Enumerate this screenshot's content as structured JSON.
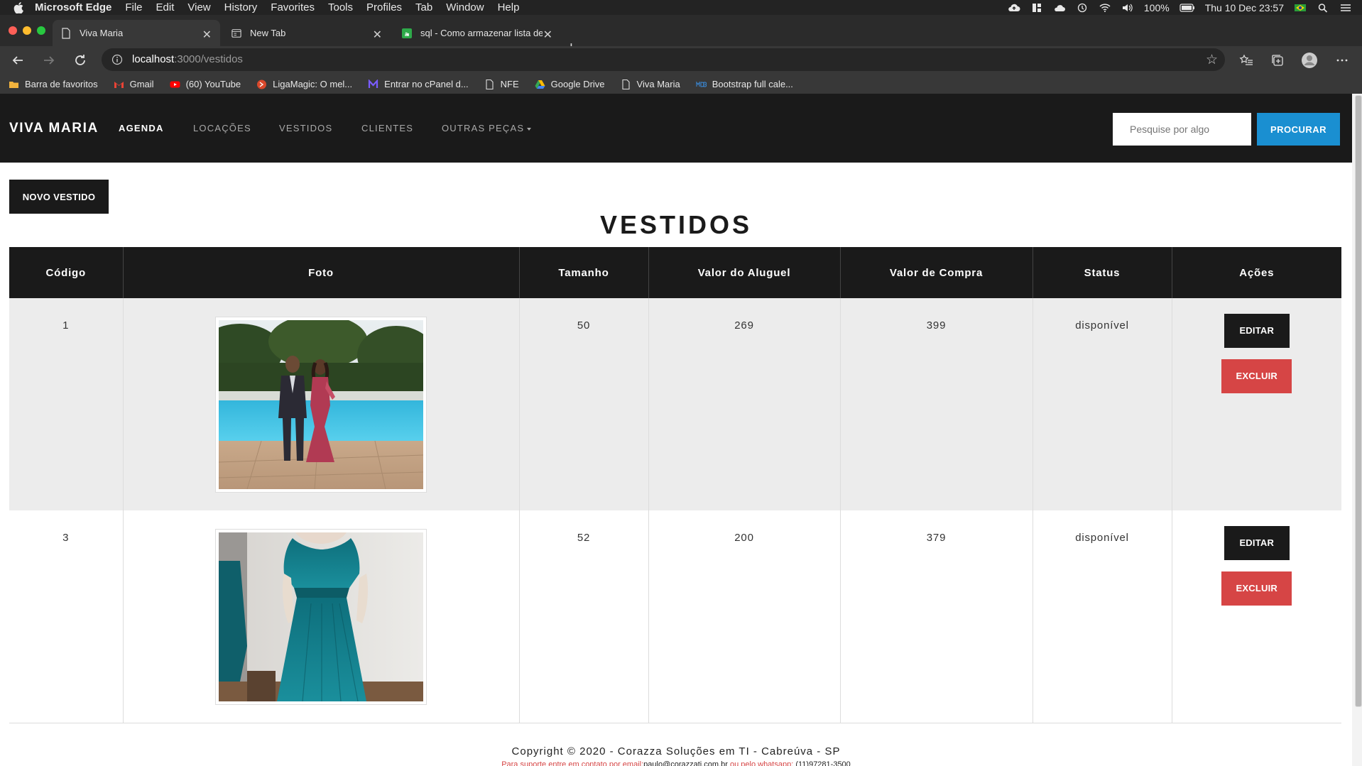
{
  "menubar": {
    "app": "Microsoft Edge",
    "items": [
      "File",
      "Edit",
      "View",
      "History",
      "Favorites",
      "Tools",
      "Profiles",
      "Tab",
      "Window",
      "Help"
    ],
    "battery": "100%",
    "datetime": "Thu 10 Dec  23:57"
  },
  "tabs": [
    {
      "label": "Viva Maria",
      "active": true
    },
    {
      "label": "New Tab",
      "active": false
    },
    {
      "label": "sql - Como armazenar lista de",
      "active": false
    }
  ],
  "address": {
    "host": "localhost",
    "path": ":3000/vestidos"
  },
  "bookmarks": [
    {
      "label": "Barra de favoritos",
      "icon": "folder-icon"
    },
    {
      "label": "Gmail",
      "icon": "gmail-icon"
    },
    {
      "label": "(60) YouTube",
      "icon": "youtube-icon"
    },
    {
      "label": "LigaMagic: O mel...",
      "icon": "ligamagic-icon"
    },
    {
      "label": "Entrar no cPanel d...",
      "icon": "cpanel-icon"
    },
    {
      "label": "NFE",
      "icon": "page-icon"
    },
    {
      "label": "Google Drive",
      "icon": "drive-icon"
    },
    {
      "label": "Viva Maria",
      "icon": "page-icon"
    },
    {
      "label": "Bootstrap full cale...",
      "icon": "mdb-icon"
    }
  ],
  "site": {
    "brand": "VIVA MARIA",
    "nav": {
      "agenda": "AGENDA",
      "locacoes": "LOCAÇÕES",
      "vestidos": "VESTIDOS",
      "clientes": "CLIENTES",
      "outras": "OUTRAS PEÇAS"
    },
    "search_placeholder": "Pesquise por algo",
    "search_button": "PROCURAR"
  },
  "main": {
    "new_button": "NOVO VESTIDO",
    "title": "VESTIDOS",
    "headers": {
      "codigo": "Código",
      "foto": "Foto",
      "tamanho": "Tamanho",
      "aluguel": "Valor do Aluguel",
      "compra": "Valor de Compra",
      "status": "Status",
      "acoes": "Ações"
    },
    "rows": [
      {
        "codigo": "1",
        "tamanho": "50",
        "aluguel": "269",
        "compra": "399",
        "status": "disponível",
        "edit": "EDITAR",
        "delete": "EXCLUIR"
      },
      {
        "codigo": "3",
        "tamanho": "52",
        "aluguel": "200",
        "compra": "379",
        "status": "disponível",
        "edit": "EDITAR",
        "delete": "EXCLUIR"
      }
    ]
  },
  "footer": {
    "copyright": "Copyright © 2020 - Corazza Soluções em TI - Cabreúva - SP",
    "support_prefix": "Para suporte entre em contato por email:",
    "email": "paulo@corazzati.com.br",
    "whatsapp_prefix": " ou pelo whatsapp: ",
    "phone": "(11)97281-3500"
  },
  "colors": {
    "accent": "#1a8fd1",
    "danger": "#d64545",
    "dark": "#1a1a1a"
  }
}
